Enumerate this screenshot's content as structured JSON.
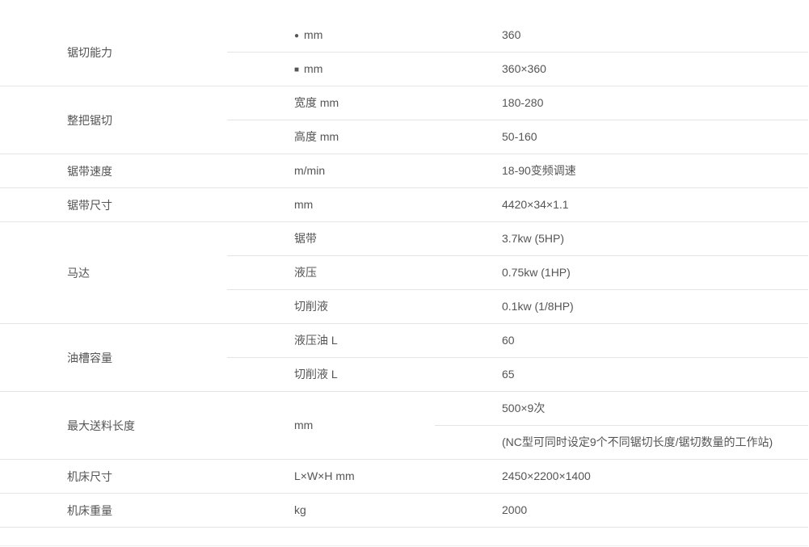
{
  "spec": {
    "groups": [
      {
        "label": "锯切能力",
        "rows": [
          {
            "glyph": "●",
            "glyph_name": "circle-icon",
            "param": "mm",
            "value": "360"
          },
          {
            "glyph": "■",
            "glyph_name": "square-icon",
            "param": "mm",
            "value": "360×360"
          }
        ]
      },
      {
        "label": "整把锯切",
        "rows": [
          {
            "param": "宽度 mm",
            "value": "180-280"
          },
          {
            "param": "高度 mm",
            "value": "50-160"
          }
        ]
      },
      {
        "label": "锯带速度",
        "rows": [
          {
            "param": "m/min",
            "value": "18-90变频调速"
          }
        ]
      },
      {
        "label": "锯带尺寸",
        "rows": [
          {
            "param": "mm",
            "value": "4420×34×1.1"
          }
        ]
      },
      {
        "label": "马达",
        "rows": [
          {
            "param": "锯带",
            "value": "3.7kw  (5HP)"
          },
          {
            "param": "液压",
            "value": "0.75kw (1HP)"
          },
          {
            "param": "切削液",
            "value": "0.1kw  (1/8HP)"
          }
        ]
      },
      {
        "label": "油槽容量",
        "rows": [
          {
            "param": "液压油 L",
            "value": "60"
          },
          {
            "param": "切削液 L",
            "value": "65"
          }
        ]
      },
      {
        "label": "最大送料长度",
        "param": "mm",
        "values": [
          "500×9次",
          "(NC型可同时设定9个不同锯切长度/锯切数量的工作站)"
        ]
      },
      {
        "label": "机床尺寸",
        "rows": [
          {
            "param": "L×W×H mm",
            "value": "2450×2200×1400"
          }
        ]
      },
      {
        "label": "机床重量",
        "rows": [
          {
            "param": "kg",
            "value": "2000"
          }
        ]
      }
    ]
  }
}
